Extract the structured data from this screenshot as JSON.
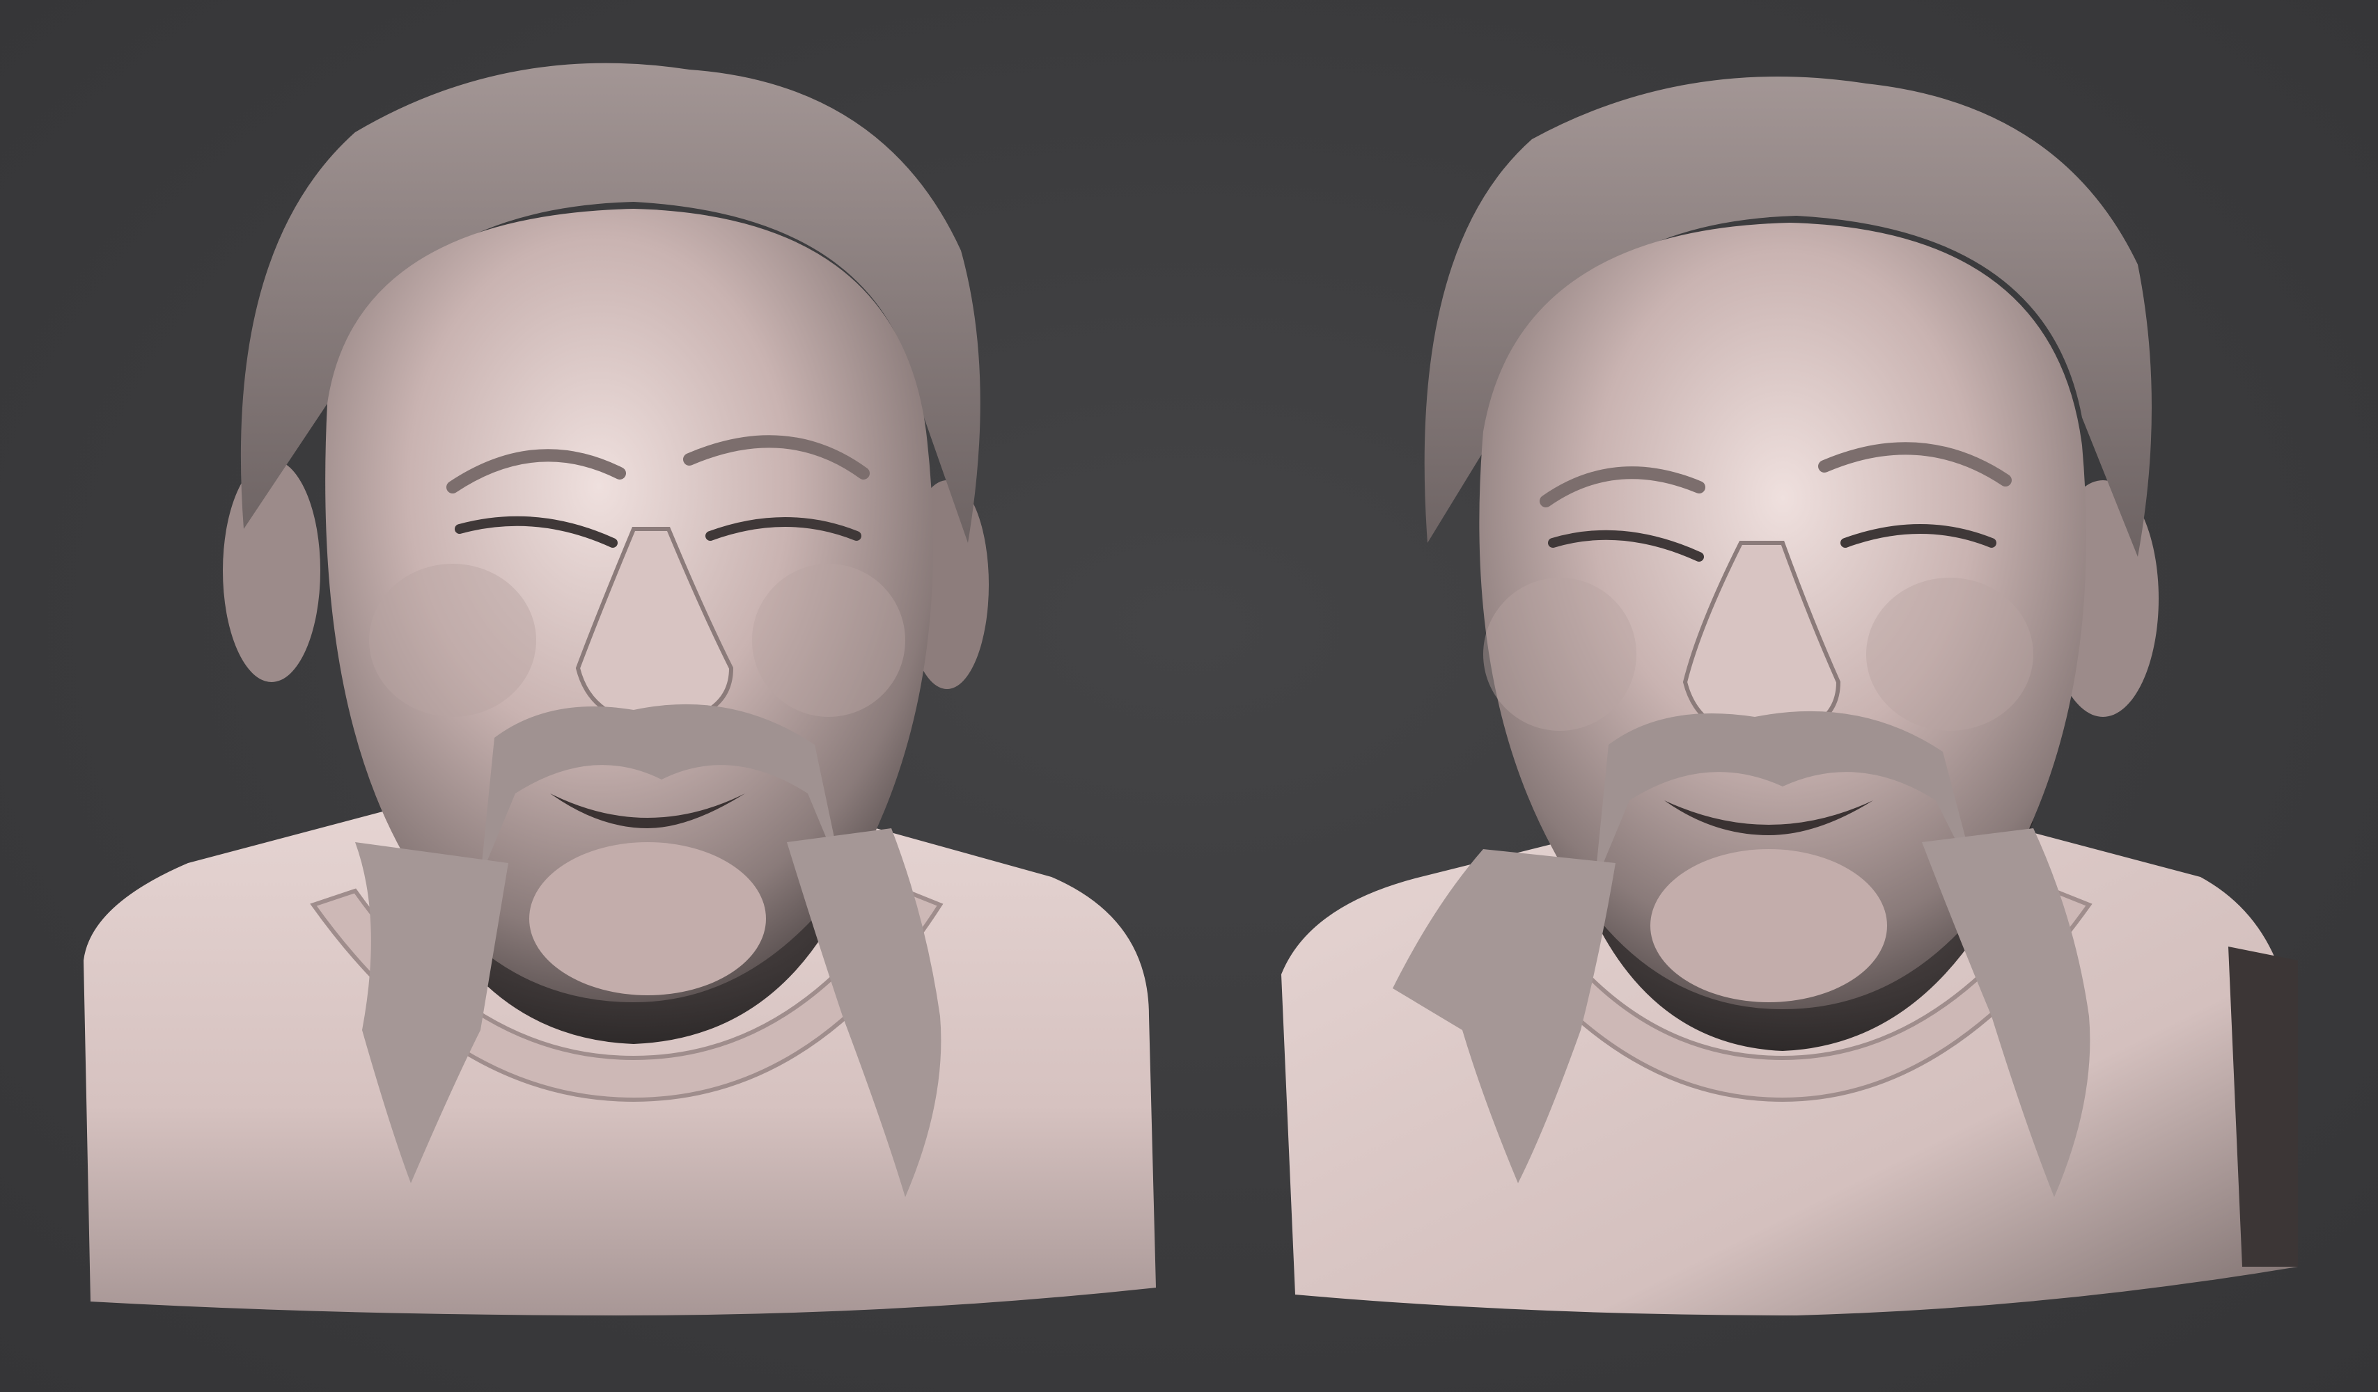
{
  "scene": {
    "background_color": "#3b3b3d",
    "material_color": "#d9c3c1",
    "material_shadow_color": "#6f6262",
    "views": [
      {
        "id": "front",
        "description_icon": "sculpted-bust-front-view"
      },
      {
        "id": "three-quarter",
        "description_icon": "sculpted-bust-three-quarter-view"
      }
    ]
  }
}
